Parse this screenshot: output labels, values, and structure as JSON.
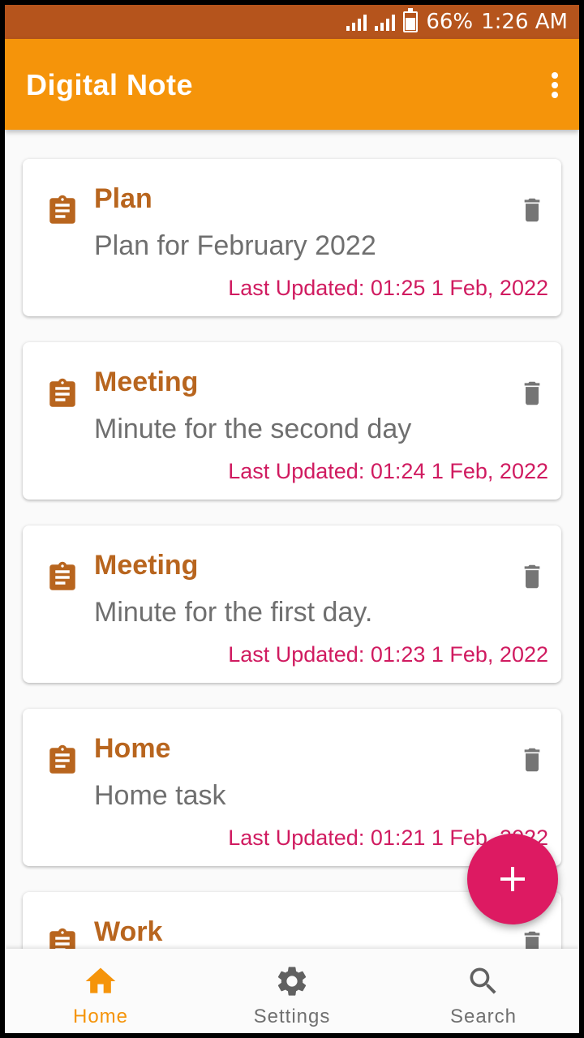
{
  "status_bar": {
    "battery": "66%",
    "time": "1:26 AM"
  },
  "app_bar": {
    "title": "Digital Note",
    "more_icon": "more-vert-icon"
  },
  "notes": [
    {
      "title": "Plan",
      "body": "Plan for February 2022",
      "updated": "Last Updated: 01:25 1 Feb, 2022"
    },
    {
      "title": "Meeting",
      "body": "Minute for the second day",
      "updated": "Last Updated: 01:24 1 Feb, 2022"
    },
    {
      "title": "Meeting",
      "body": "Minute for the first day.",
      "updated": "Last Updated: 01:23 1 Feb, 2022"
    },
    {
      "title": "Home",
      "body": "Home task",
      "updated": "Last Updated: 01:21 1 Feb, 2022"
    },
    {
      "title": "Work",
      "body": "",
      "updated": ""
    }
  ],
  "fab": {
    "icon": "plus-icon"
  },
  "bottom_nav": {
    "items": [
      {
        "label": "Home",
        "icon": "home-icon",
        "active": true
      },
      {
        "label": "Settings",
        "icon": "gear-icon",
        "active": false
      },
      {
        "label": "Search",
        "icon": "search-icon",
        "active": false
      }
    ]
  },
  "colors": {
    "status_bar": "#b5541c",
    "app_bar": "#f5940a",
    "note_title": "#b8651e",
    "updated_text": "#d01b60",
    "fab": "#dd1a62",
    "nav_active": "#f5940a"
  }
}
